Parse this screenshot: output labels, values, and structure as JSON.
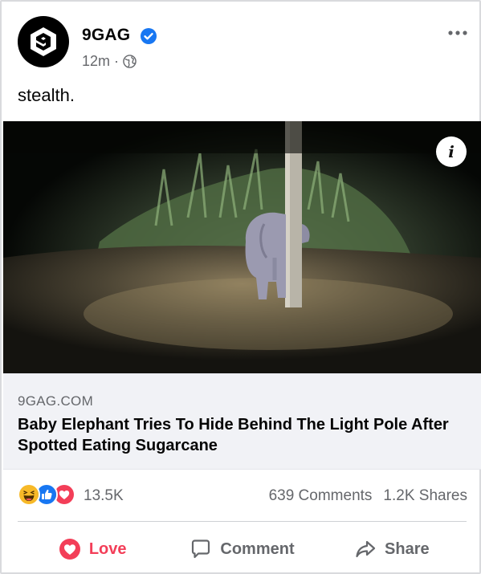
{
  "post": {
    "page_name": "9GAG",
    "time": "12m",
    "separator": "·",
    "caption": "stealth."
  },
  "link": {
    "domain": "9GAG.COM",
    "headline": "Baby Elephant Tries To Hide Behind The Light Pole After Spotted Eating Sugarcane"
  },
  "stats": {
    "reaction_count": "13.5K",
    "comments": "639 Comments",
    "shares": "1.2K Shares"
  },
  "actions": {
    "love": "Love",
    "comment": "Comment",
    "share": "Share"
  },
  "colors": {
    "love": "#f33e58",
    "verified": "#1877f2",
    "muted": "#65676b"
  },
  "icons": [
    "9gag-logo-icon",
    "verified-badge-icon",
    "globe-icon",
    "more-options-icon",
    "info-icon",
    "haha-reaction-icon",
    "like-reaction-icon",
    "love-reaction-icon",
    "love-heart-icon",
    "comment-icon",
    "share-icon"
  ]
}
